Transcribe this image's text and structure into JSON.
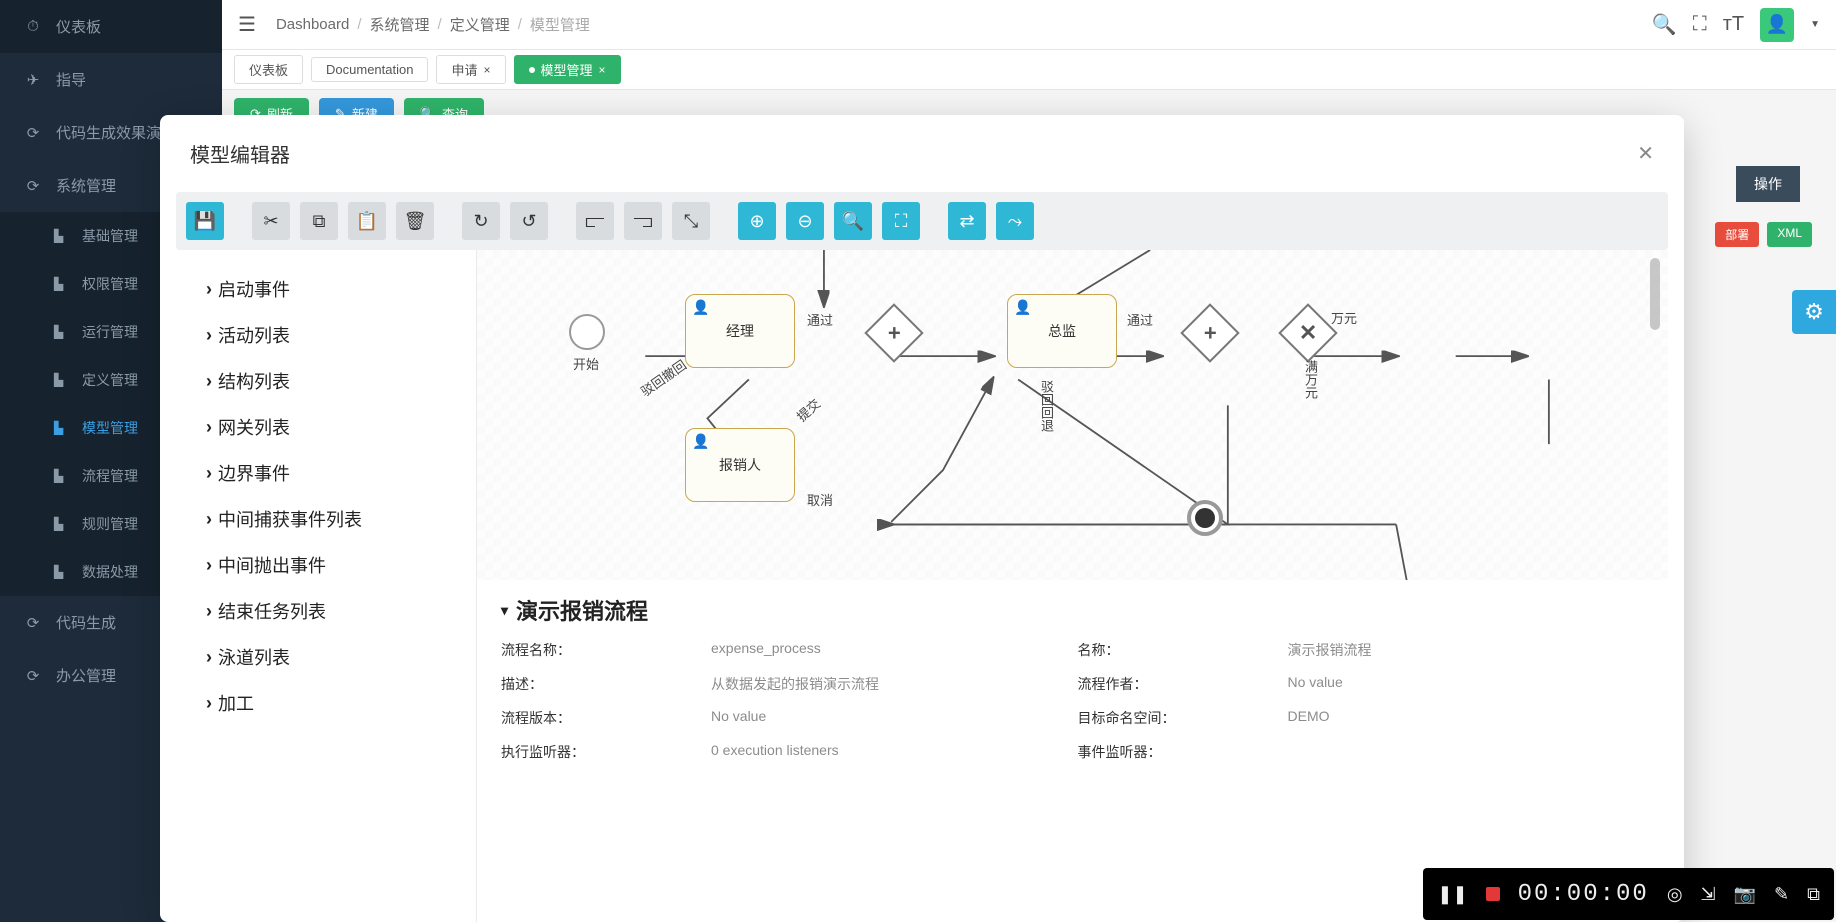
{
  "sidebar": {
    "items": [
      {
        "icon": "⏱",
        "label": "仪表板"
      },
      {
        "icon": "✈",
        "label": "指导"
      },
      {
        "icon": "✦",
        "label": "代码生成效果演"
      },
      {
        "icon": "✦",
        "label": "系统管理"
      }
    ],
    "subs": [
      {
        "icon": "▙",
        "label": "基础管理"
      },
      {
        "icon": "▙",
        "label": "权限管理"
      },
      {
        "icon": "▙",
        "label": "运行管理"
      },
      {
        "icon": "▙",
        "label": "定义管理"
      },
      {
        "icon": "▙",
        "label": "模型管理"
      },
      {
        "icon": "▙",
        "label": "流程管理"
      },
      {
        "icon": "▙",
        "label": "规则管理"
      },
      {
        "icon": "▙",
        "label": "数据处理"
      }
    ],
    "bottom": [
      {
        "icon": "✦",
        "label": "代码生成"
      },
      {
        "icon": "✦",
        "label": "办公管理"
      }
    ]
  },
  "breadcrumb": [
    "Dashboard",
    "系统管理",
    "定义管理",
    "模型管理"
  ],
  "tabs": [
    {
      "label": "仪表板",
      "active": false,
      "closable": false
    },
    {
      "label": "Documentation",
      "active": false,
      "closable": false
    },
    {
      "label": "申请",
      "active": false,
      "closable": true
    },
    {
      "label": "模型管理",
      "active": true,
      "closable": true
    }
  ],
  "actions": {
    "refresh": "刷新",
    "new": "新建",
    "query": "查询"
  },
  "column_op": "操作",
  "pills": {
    "deploy": "部署",
    "xml": "XML"
  },
  "modal": {
    "title": "模型编辑器",
    "palette": [
      "启动事件",
      "活动列表",
      "结构列表",
      "网关列表",
      "边界事件",
      "中间捕获事件列表",
      "中间抛出事件",
      "结束任务列表",
      "泳道列表",
      "加工"
    ],
    "diagram": {
      "start": "开始",
      "task_manager": "经理",
      "task_director": "总监",
      "task_submitter": "报销人",
      "lbl_pass1": "通过",
      "lbl_pass2": "通过",
      "lbl_reject": "驳回撤回",
      "lbl_submit": "提交",
      "lbl_cancel": "取消",
      "lbl_rejectback": "驳回回退",
      "lbl_wany": "万元",
      "lbl_manwy": "满万元"
    },
    "props_title": "演示报销流程",
    "props": [
      {
        "k": "流程名称：",
        "v": "expense_process"
      },
      {
        "k": "名称：",
        "v": "演示报销流程"
      },
      {
        "k": "描述：",
        "v": "从数据发起的报销演示流程"
      },
      {
        "k": "流程作者：",
        "v": "No value"
      },
      {
        "k": "流程版本：",
        "v": "No value"
      },
      {
        "k": "目标命名空间：",
        "v": "DEMO"
      },
      {
        "k": "执行监听器：",
        "v": "0 execution listeners"
      },
      {
        "k": "事件监听器：",
        "v": ""
      }
    ]
  },
  "recorder": {
    "time": "00:00:00"
  }
}
